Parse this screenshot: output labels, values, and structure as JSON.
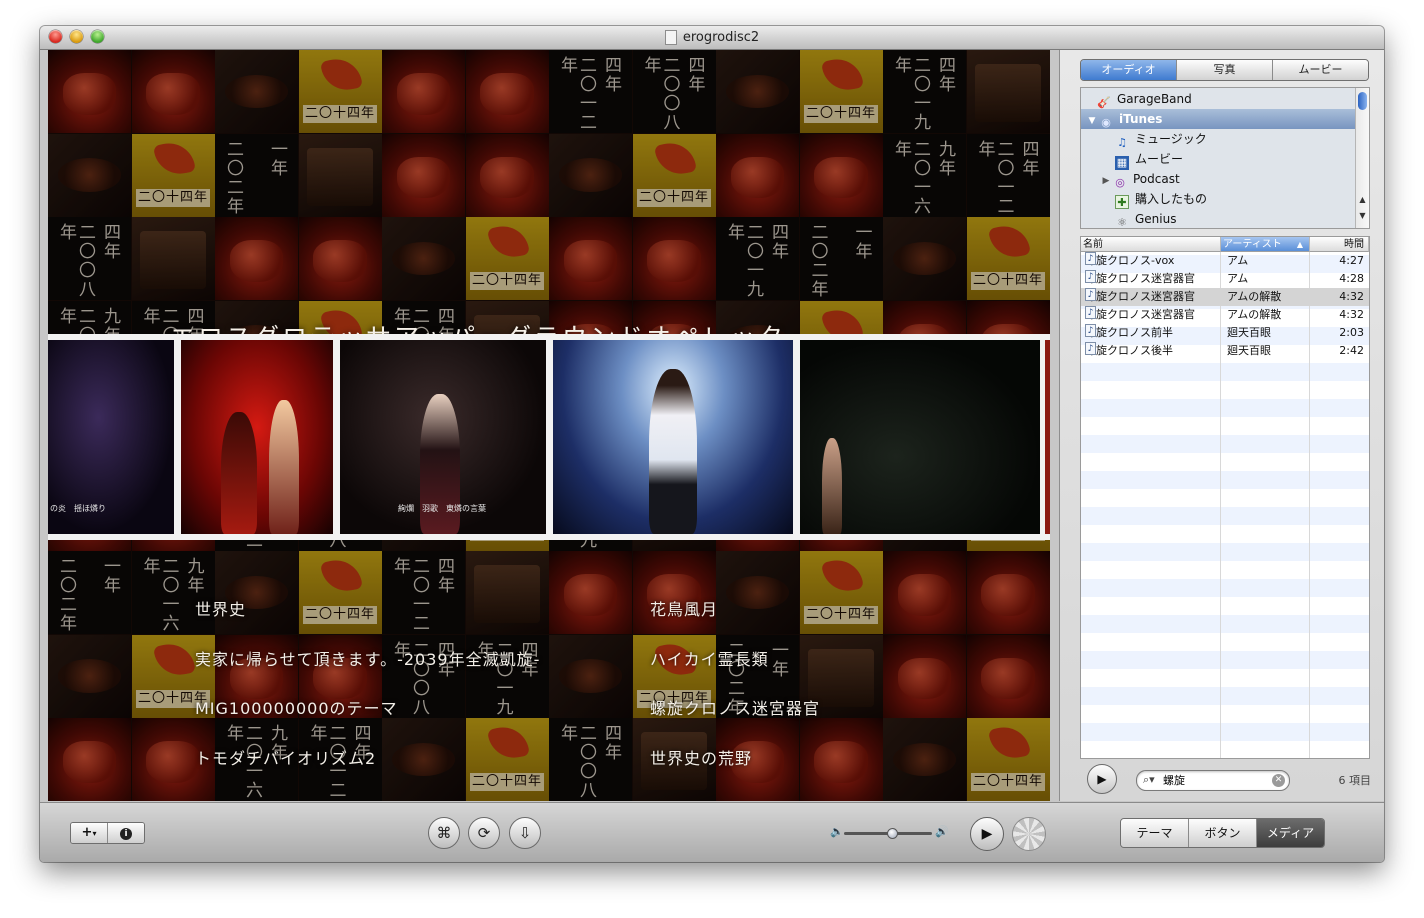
{
  "window": {
    "title": "erogrodisc2"
  },
  "preview": {
    "main_title": "エロスグロテッサアッパーグラウンドオペレッタ",
    "tile_kanji": [
      [
        "二〇一二年",
        "四年"
      ],
      [
        "二〇〇八年",
        "四年"
      ],
      [
        "二〇一九年",
        "四年"
      ],
      [
        "二〇二年",
        "一年"
      ],
      [
        "二〇一六年",
        "九年"
      ]
    ],
    "photo_captions": [
      "の炎　揺ほ燐り",
      "絢爛　羽歌　東燐の言葉"
    ],
    "songs": [
      "世界史",
      "花鳥風月",
      "実家に帰らせて頂きます。-2039年全滅凱旋-",
      "ハイカイ霊長類",
      "MIG100000000のテーマ",
      "螺旋クロノス迷宮器官",
      "トモダチバイオリズム2",
      "世界史の荒野"
    ]
  },
  "browser": {
    "tabs": [
      "オーディオ",
      "写真",
      "ムービー"
    ],
    "active_tab": "オーディオ",
    "sources": [
      {
        "label": "GarageBand",
        "icon": "guitar-icon",
        "indent": 0,
        "disclosure": ""
      },
      {
        "label": "iTunes",
        "icon": "itunes-icon",
        "indent": 0,
        "disclosure": "▼",
        "selected": true
      },
      {
        "label": "ミュージック",
        "icon": "music-note-icon",
        "indent": 1,
        "disclosure": ""
      },
      {
        "label": "ムービー",
        "icon": "film-icon",
        "indent": 1,
        "disclosure": ""
      },
      {
        "label": "Podcast",
        "icon": "podcast-icon",
        "indent": 1,
        "disclosure": "▶"
      },
      {
        "label": "購入したもの",
        "icon": "purchased-icon",
        "indent": 1,
        "disclosure": ""
      },
      {
        "label": "Genius",
        "icon": "genius-icon",
        "indent": 1,
        "disclosure": ""
      }
    ],
    "columns": {
      "name": "名前",
      "artist": "アーティスト",
      "time": "時間"
    },
    "sort_indicator": "▲",
    "tracks": [
      {
        "name": "螺旋クロノス-vox",
        "artist": "アム",
        "time": "4:27"
      },
      {
        "name": "螺旋クロノス迷宮器官",
        "artist": "アム",
        "time": "4:28"
      },
      {
        "name": "螺旋クロノス迷宮器官",
        "artist": "アムの解散",
        "time": "4:32",
        "selected": true
      },
      {
        "name": "螺旋クロノス迷宮器官",
        "artist": "アムの解散",
        "time": "4:32"
      },
      {
        "name": "螺旋クロノス前半",
        "artist": "廻天百眼",
        "time": "2:03"
      },
      {
        "name": "螺旋クロノス後半",
        "artist": "廻天百眼",
        "time": "2:42"
      }
    ],
    "search": {
      "value": "螺旋",
      "placeholder": ""
    },
    "item_count": "6 項目"
  },
  "toolbar": {
    "add_label": "+",
    "add_menu_indicator": "▾",
    "info_label": "i",
    "volume_level": 0.55,
    "mode_tabs": [
      "テーマ",
      "ボタン",
      "メディア"
    ],
    "active_mode": "メディア"
  }
}
